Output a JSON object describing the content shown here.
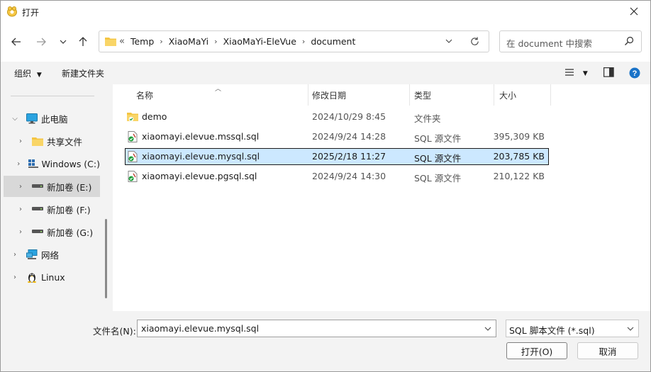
{
  "window": {
    "title": "打开"
  },
  "navigation": {
    "back_icon": "arrow-left-icon",
    "forward_icon": "arrow-right-icon",
    "recent_icon": "chevron-down-icon",
    "up_icon": "arrow-up-icon",
    "breadcrumbs": [
      "Temp",
      "XiaoMaYi",
      "XiaoMaYi-EleVue",
      "document"
    ],
    "overflow": "«",
    "search_placeholder": "在 document 中搜索"
  },
  "toolbar": {
    "organize_label": "组织",
    "new_folder_label": "新建文件夹"
  },
  "sidebar": {
    "items": [
      {
        "label": "此电脑",
        "icon": "computer-icon",
        "expanded": true
      },
      {
        "label": "共享文件",
        "icon": "folder-icon"
      },
      {
        "label": "Windows (C:)",
        "icon": "windows-drive-icon"
      },
      {
        "label": "新加卷 (E:)",
        "icon": "drive-icon",
        "selected": true
      },
      {
        "label": "新加卷 (F:)",
        "icon": "drive-icon"
      },
      {
        "label": "新加卷 (G:)",
        "icon": "drive-icon"
      },
      {
        "label": "网络",
        "icon": "network-icon"
      },
      {
        "label": "Linux",
        "icon": "linux-icon"
      }
    ]
  },
  "files": {
    "columns": {
      "name": "名称",
      "modified": "修改日期",
      "type": "类型",
      "size": "大小"
    },
    "rows": [
      {
        "name": "demo",
        "modified": "2024/10/29 8:45",
        "type": "文件夹",
        "size": "",
        "icon": "folder-icon"
      },
      {
        "name": "xiaomayi.elevue.mssql.sql",
        "modified": "2024/9/24 14:28",
        "type": "SQL 源文件",
        "size": "395,309 KB",
        "icon": "sql-file-icon"
      },
      {
        "name": "xiaomayi.elevue.mysql.sql",
        "modified": "2025/2/18 11:27",
        "type": "SQL 源文件",
        "size": "203,785 KB",
        "icon": "sql-file-icon",
        "selected": true
      },
      {
        "name": "xiaomayi.elevue.pgsql.sql",
        "modified": "2024/9/24 14:30",
        "type": "SQL 源文件",
        "size": "210,122 KB",
        "icon": "sql-file-icon"
      }
    ]
  },
  "footer": {
    "filename_label": "文件名(N):",
    "filename_value": "xiaomayi.elevue.mysql.sql",
    "filetype_value": "SQL 脚本文件 (*.sql)",
    "open_label": "打开(O)",
    "cancel_label": "取消"
  },
  "colors": {
    "selection": "#cce8ff",
    "help": "#1a73c8",
    "folder": "#f4c542"
  }
}
